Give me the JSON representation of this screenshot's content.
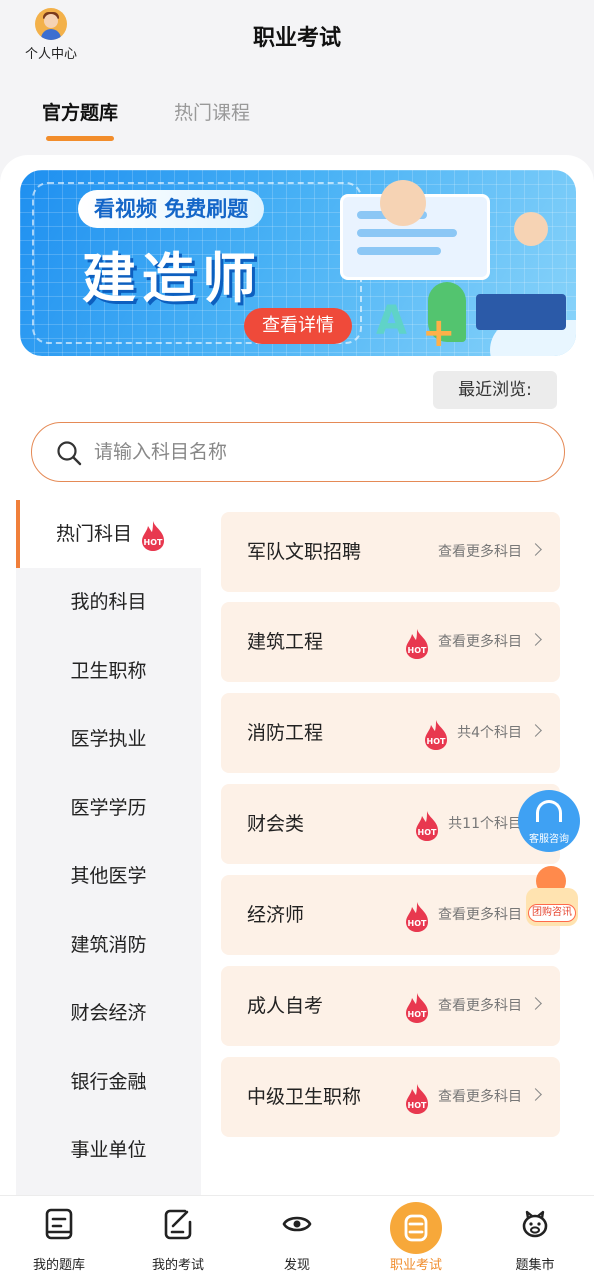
{
  "header": {
    "profile_label": "个人中心",
    "title": "职业考试",
    "tabs": [
      {
        "label": "官方题库",
        "active": true
      },
      {
        "label": "热门课程",
        "active": false
      }
    ]
  },
  "banner": {
    "tag": "看视频 免费刷题",
    "headline": "建造师",
    "button": "查看详情"
  },
  "recent_label": "最近浏览:",
  "search": {
    "placeholder": "请输入科目名称"
  },
  "sidebar": {
    "items": [
      {
        "label": "热门科目",
        "active": true,
        "hot": true
      },
      {
        "label": "我的科目"
      },
      {
        "label": "卫生职称"
      },
      {
        "label": "医学执业"
      },
      {
        "label": "医学学历"
      },
      {
        "label": "其他医学"
      },
      {
        "label": "建筑消防"
      },
      {
        "label": "财会经济"
      },
      {
        "label": "银行金融"
      },
      {
        "label": "事业单位"
      }
    ]
  },
  "categories": [
    {
      "name": "军队文职招聘",
      "more": "查看更多科目",
      "hot": false
    },
    {
      "name": "建筑工程",
      "more": "查看更多科目",
      "hot": true
    },
    {
      "name": "消防工程",
      "more": "共4个科目",
      "hot": true
    },
    {
      "name": "财会类",
      "more": "共11个科目",
      "hot": true
    },
    {
      "name": "经济师",
      "more": "查看更多科目",
      "hot": true
    },
    {
      "name": "成人自考",
      "more": "查看更多科目",
      "hot": true
    },
    {
      "name": "中级卫生职称",
      "more": "查看更多科目",
      "hot": true
    }
  ],
  "hot_text": "HOT",
  "floating": {
    "service_label": "客服咨询",
    "group_label": "团购咨讯"
  },
  "bottom_nav": [
    {
      "label": "我的题库",
      "icon": "book-icon"
    },
    {
      "label": "我的考试",
      "icon": "edit-icon"
    },
    {
      "label": "发现",
      "icon": "eye-icon"
    },
    {
      "label": "职业考试",
      "icon": "exam-icon",
      "active": true
    },
    {
      "label": "题集市",
      "icon": "piggy-icon"
    }
  ],
  "colors": {
    "accent": "#f08d2d",
    "hot": "#e8384f",
    "card_bg": "#fdf1e7"
  }
}
